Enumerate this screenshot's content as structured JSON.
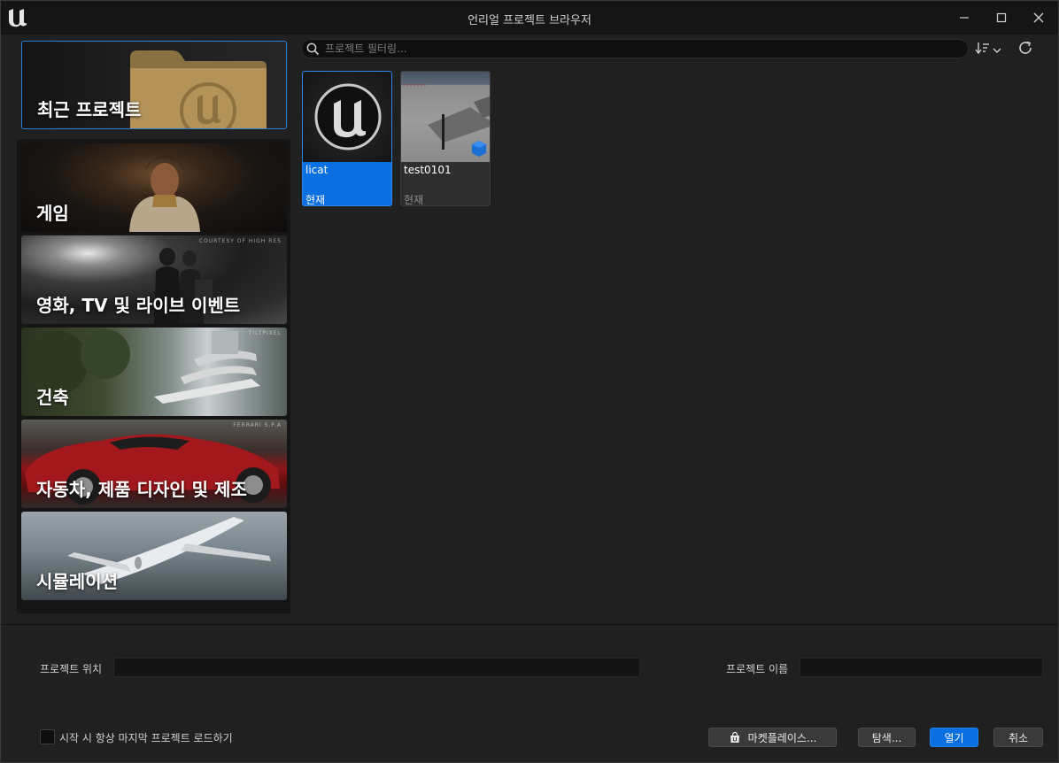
{
  "window": {
    "title": "언리얼 프로젝트 브라우저",
    "controls": {
      "minimize": "minimize-icon",
      "maximize": "maximize-icon",
      "close": "close-icon"
    }
  },
  "categories": {
    "recent": "최근 프로젝트",
    "items": [
      {
        "label": "게임",
        "credit": ""
      },
      {
        "label": "영화, TV 및 라이브 이벤트",
        "credit": "COURTESY OF HIGH RES"
      },
      {
        "label": "건축",
        "credit": "TILTPIXEL"
      },
      {
        "label": "자동차, 제품 디자인 및 제조",
        "credit": "FERRARI S.P.A"
      },
      {
        "label": "시뮬레이션",
        "credit": ""
      }
    ]
  },
  "search": {
    "placeholder": "프로젝트 필터링..."
  },
  "projects": [
    {
      "name": "licat",
      "status": "현재",
      "selected": true
    },
    {
      "name": "test0101",
      "status": "현재",
      "selected": false
    }
  ],
  "footer": {
    "location_label": "프로젝트 위치",
    "location_value": "",
    "name_label": "프로젝트 이름",
    "name_value": "",
    "startup_checkbox": "시작 시 항상 마지막 프로젝트 로드하기",
    "marketplace_button": "마켓플레이스...",
    "browse_button": "탐색...",
    "open_button": "열기",
    "cancel_button": "취소"
  },
  "colors": {
    "accent": "#0a6fe0",
    "background": "#202020",
    "titlebar": "#151515"
  }
}
